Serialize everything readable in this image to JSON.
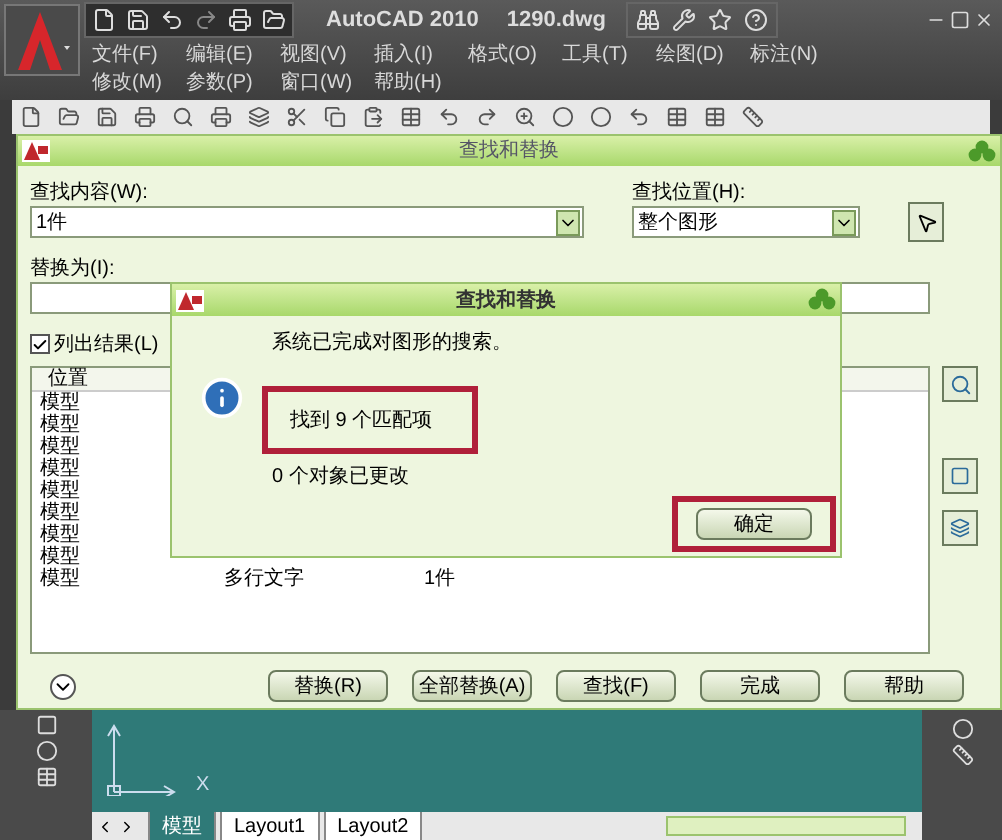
{
  "app_title": "AutoCAD 2010",
  "file_name": "1290.dwg",
  "menu_rows": [
    [
      "文件(F)",
      "编辑(E)",
      "视图(V)",
      "插入(I)",
      "格式(O)",
      "工具(T)",
      "绘图(D)",
      "标注(N)"
    ],
    [
      "修改(M)",
      "参数(P)",
      "窗口(W)",
      "帮助(H)"
    ]
  ],
  "dialog": {
    "title": "查找和替换",
    "find_label": "查找内容(W):",
    "find_value": "1件",
    "where_label": "查找位置(H):",
    "where_value": "整个图形",
    "replace_label": "替换为(I):",
    "list_results": {
      "label": "列出结果(L)",
      "checked": true
    },
    "results": {
      "columns": [
        "位置"
      ],
      "rows": [
        [
          "模型"
        ],
        [
          "模型"
        ],
        [
          "模型"
        ],
        [
          "模型"
        ],
        [
          "模型"
        ],
        [
          "模型"
        ],
        [
          "模型"
        ],
        [
          "模型"
        ],
        [
          "模型",
          "多行文字",
          "1件"
        ]
      ]
    },
    "buttons": [
      "替换(R)",
      "全部替换(A)",
      "查找(F)",
      "完成",
      "帮助"
    ]
  },
  "message": {
    "title": "查找和替换",
    "text": "系统已完成对图形的搜索。",
    "found": "找到 9 个匹配项",
    "changed": "0 个对象已更改",
    "ok": "确定"
  },
  "canvas": {
    "axis_label": "X",
    "tabs": [
      {
        "label": "模型",
        "selected": true
      },
      {
        "label": "Layout1",
        "selected": false
      },
      {
        "label": "Layout2",
        "selected": false
      }
    ]
  }
}
